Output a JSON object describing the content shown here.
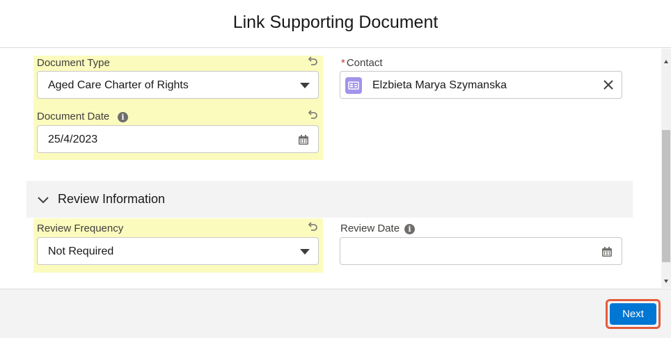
{
  "modal": {
    "title": "Link Supporting Document"
  },
  "fields": {
    "document_type": {
      "label": "Document Type",
      "value": "Aged Care Charter of Rights"
    },
    "document_date": {
      "label": "Document Date",
      "value": "25/4/2023"
    },
    "contact": {
      "label": "Contact",
      "required_marker": "*",
      "value": "Elzbieta Marya Szymanska"
    },
    "review_frequency": {
      "label": "Review Frequency",
      "value": "Not Required"
    },
    "review_date": {
      "label": "Review Date",
      "value": ""
    }
  },
  "section": {
    "title": "Review Information",
    "expanded": true
  },
  "footer": {
    "next_label": "Next"
  },
  "colors": {
    "highlight": "#fbfbbe",
    "brand_button": "#0176d3",
    "focus_outline": "#e25c3c",
    "contact_icon": "#a094ed"
  },
  "icons": {
    "undo": "undo-icon",
    "info": "info-icon",
    "calendar": "calendar-icon",
    "caret": "chevron-down-icon",
    "clear": "close-icon",
    "contact": "contact-card-icon"
  }
}
